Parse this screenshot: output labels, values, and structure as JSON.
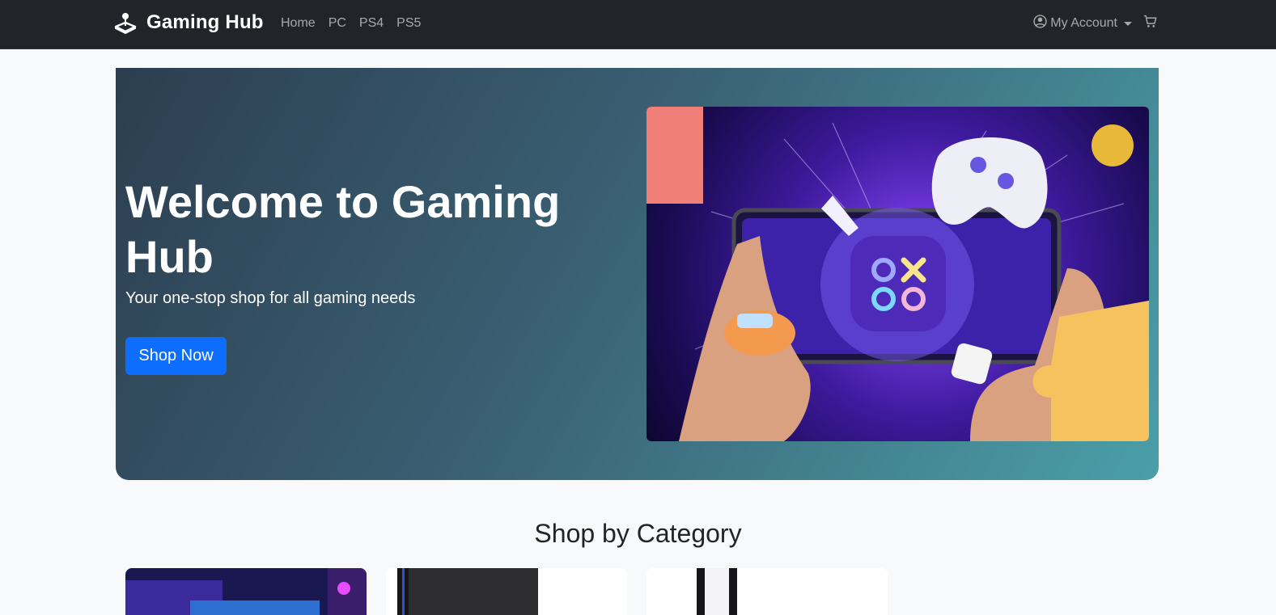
{
  "navbar": {
    "brand": "Gaming Hub",
    "links": [
      "Home",
      "PC",
      "PS4",
      "PS5"
    ],
    "account_label": "My Account",
    "icons": {
      "brand": "joystick-icon",
      "account": "person-circle-icon",
      "cart": "cart-icon",
      "caret": "caret-down-icon"
    }
  },
  "hero": {
    "title": "Welcome to Gaming Hub",
    "subtitle": "Your one-stop shop for all gaming needs",
    "cta": "Shop Now"
  },
  "categories": {
    "title": "Shop by Category"
  },
  "colors": {
    "navbar_bg": "#212529",
    "primary": "#0d6efd",
    "page_bg": "#f8f9fa",
    "hero_gradient_start": "#2c3e50",
    "hero_gradient_end": "#4a9fa8"
  }
}
